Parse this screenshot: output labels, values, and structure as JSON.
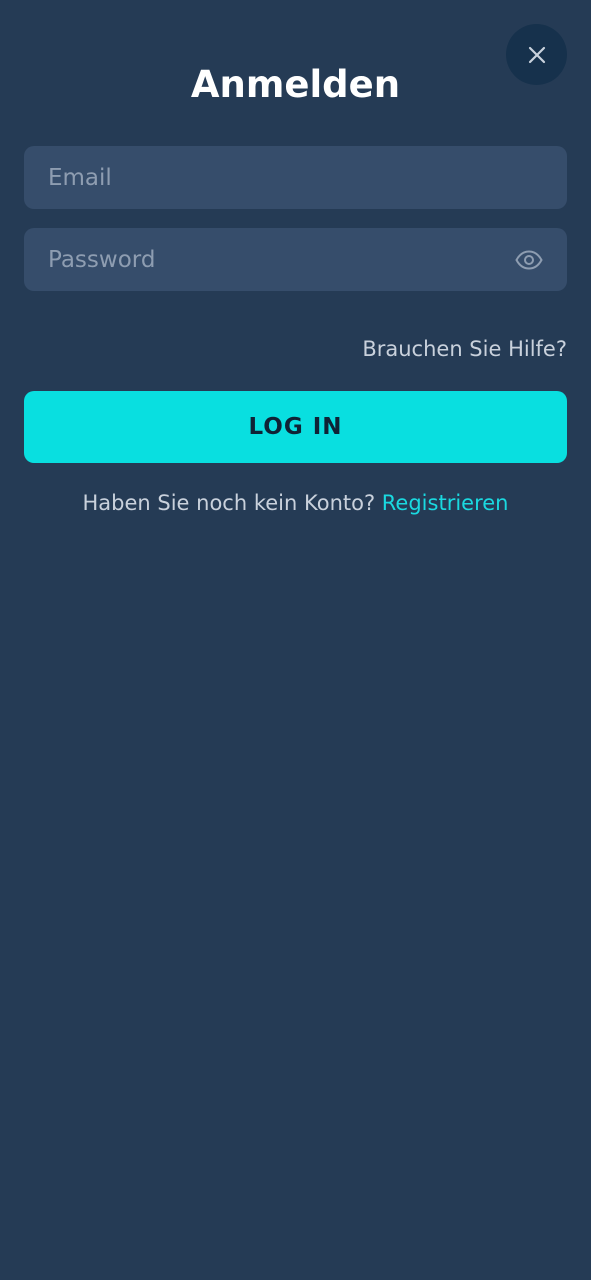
{
  "modal": {
    "title": "Anmelden"
  },
  "form": {
    "email": {
      "value": "",
      "placeholder": "Email"
    },
    "password": {
      "value": "",
      "placeholder": "Password"
    },
    "help_link": "Brauchen Sie Hilfe?",
    "login_button": "LOG IN",
    "register_prompt": "Haben Sie noch kein Konto?",
    "register_link": "Registrieren"
  },
  "icons": {
    "close": "close-icon",
    "toggle_password": "eye-icon"
  },
  "colors": {
    "background": "#253b55",
    "field_background": "#364d6b",
    "accent": "#09dfe0",
    "close_button": "#16314c"
  }
}
